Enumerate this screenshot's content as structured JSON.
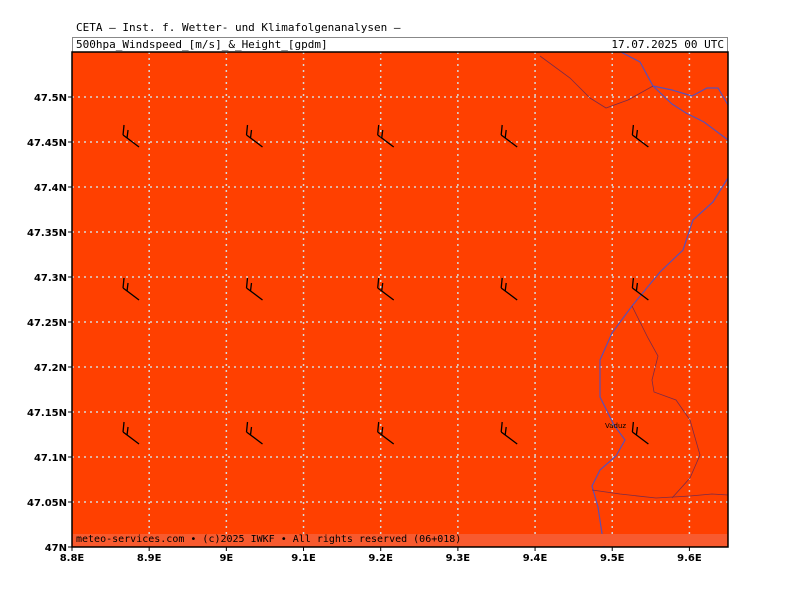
{
  "header": {
    "title": "CETA – Inst. f. Wetter- und Klimafolgenanalysen –",
    "subtitle": "500hpa_Windspeed_[m/s]_&_Height_[gpdm]",
    "valid_time": "17.07.2025 00 UTC"
  },
  "map": {
    "fill_color": "#ff4000",
    "grid_color": "#d8d8d8",
    "border_color": "#5a4fb8",
    "lon_range": [
      8.8,
      9.65
    ],
    "lat_range": [
      47.0,
      47.55
    ],
    "lat_ticks": [
      "47N",
      "47.05N",
      "47.1N",
      "47.15N",
      "47.2N",
      "47.25N",
      "47.3N",
      "47.35N",
      "47.4N",
      "47.45N",
      "47.5N"
    ],
    "lon_ticks": [
      "8.8E",
      "8.9E",
      "9E",
      "9.1E",
      "9.2E",
      "9.3E",
      "9.4E",
      "9.5E",
      "9.6E"
    ],
    "place_label": "Vaduz"
  },
  "wind_barbs": {
    "rows_lat": [
      47.45,
      47.28,
      47.12
    ],
    "cols_lon": [
      8.87,
      9.03,
      9.2,
      9.36,
      9.53
    ]
  },
  "footer": {
    "text": "meteo-services.com • (c)2025 IWKF • All rights reserved (06+018)"
  }
}
